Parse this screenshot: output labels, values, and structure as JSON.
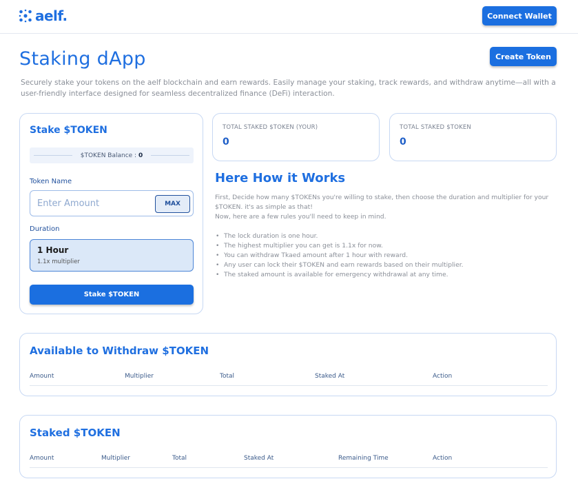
{
  "header": {
    "logo_text": "aelf.",
    "connect_label": "Connect Wallet"
  },
  "page": {
    "title": "Staking dApp",
    "create_token_label": "Create Token",
    "description": "Securely stake your tokens on the aelf blockchain and earn rewards. Easily manage your staking, track rewards, and withdraw anytime—all with a user-friendly interface designed for seamless decentralized finance (DeFi) interaction."
  },
  "stake": {
    "title": "Stake $TOKEN",
    "balance_label": "$TOKEN Balance :",
    "balance_value": "0",
    "token_name_label": "Token Name",
    "amount_placeholder": "Enter Amount",
    "max_label": "MAX",
    "duration_label": "Duration",
    "duration_option": {
      "title": "1 Hour",
      "subtitle": "1.1x multiplier"
    },
    "submit_label": "Stake $TOKEN"
  },
  "stats": [
    {
      "label": "TOTAL STAKED $TOKEN (YOUR)",
      "value": "0"
    },
    {
      "label": "TOTAL STAKED $TOKEN",
      "value": "0"
    }
  ],
  "how": {
    "title": "Here How it Works",
    "intro_1": "First, Decide how many $TOKENs you're willing to stake, then choose the duration and multiplier for your $TOKEN. it's as simple as that!",
    "intro_2": "Now, here are a few rules you'll need to keep in mind.",
    "rules": [
      "The lock duration is one hour.",
      "The highest multiplier you can get is 1.1x for now.",
      "You can withdraw Tkaed amount after 1 hour with reward.",
      "Any user can lock their $TOKEN and earn rewards based on their multiplier.",
      "The staked amount is available for emergency withdrawal at any time."
    ]
  },
  "withdraw": {
    "title": "Available to Withdraw $TOKEN",
    "columns": [
      "Amount",
      "Multiplier",
      "Total",
      "Staked At",
      "Action"
    ]
  },
  "staked": {
    "title": "Staked $TOKEN",
    "columns": [
      "Amount",
      "Multiplier",
      "Total",
      "Staked At",
      "Remaining Time",
      "Action"
    ]
  },
  "colors": {
    "primary": "#1b6fe0",
    "title_blue": "#1f6fe0",
    "card_border": "#c7d8f3",
    "muted_text": "#8a8f98"
  }
}
